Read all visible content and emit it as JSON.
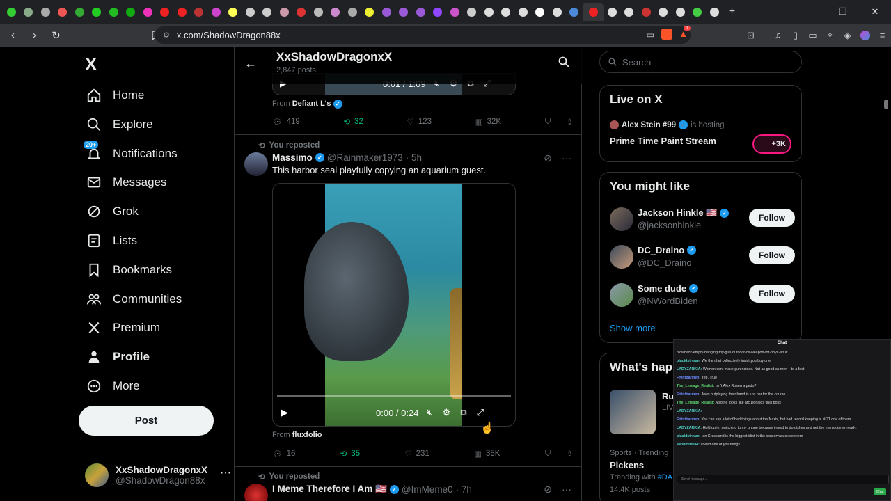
{
  "browser": {
    "url": "x.com/ShadowDragon88x",
    "tabs_count": 46,
    "new_tab": "+",
    "ext_badge": "1"
  },
  "nav": {
    "logo": "X",
    "items": [
      {
        "label": "Home",
        "icon": "home-icon"
      },
      {
        "label": "Explore",
        "icon": "search-icon"
      },
      {
        "label": "Notifications",
        "icon": "bell-icon"
      },
      {
        "label": "Messages",
        "icon": "mail-icon"
      },
      {
        "label": "Grok",
        "icon": "grok-icon"
      },
      {
        "label": "Lists",
        "icon": "list-icon"
      },
      {
        "label": "Bookmarks",
        "icon": "bookmark-icon"
      },
      {
        "label": "Communities",
        "icon": "people-icon"
      },
      {
        "label": "Premium",
        "icon": "x-icon"
      },
      {
        "label": "Profile",
        "icon": "person-icon"
      },
      {
        "label": "More",
        "icon": "more-icon"
      }
    ],
    "notif_badge": "20+",
    "post_label": "Post",
    "account_name": "XxShadowDragonxX",
    "account_handle": "@ShadowDragon88x",
    "account_more": "···"
  },
  "header": {
    "title": "XxShadowDragonxX",
    "subtitle": "2,847 posts"
  },
  "tweet1": {
    "video_time": "0:01 / 1:09",
    "from_label": "From",
    "from_name": "Defiant L's",
    "replies": "419",
    "reposts": "32",
    "likes": "123",
    "views": "32K"
  },
  "tweet2": {
    "reposted": "You reposted",
    "name": "Massimo",
    "handle": "@Rainmaker1973",
    "time": "· 5h",
    "text": "This harbor seal playfully copying an aquarium guest.",
    "video_time": "0:00 / 0:24",
    "from_label": "From",
    "from_name": "fluxfolio",
    "replies": "16",
    "reposts": "35",
    "likes": "231",
    "views": "35K"
  },
  "tweet3": {
    "reposted": "You reposted",
    "name": "I Meme Therefore I Am 🇺🇸",
    "handle": "@ImMeme0",
    "time": "· 7h"
  },
  "right": {
    "search_placeholder": "Search",
    "live_title": "Live on X",
    "live_host": "Alex Stein #99",
    "live_hosting": "is hosting",
    "live_stream": "Prime Time Paint Stream",
    "live_count": "+3K",
    "might_like_title": "You might like",
    "suggestions": [
      {
        "name": "Jackson Hinkle 🇺🇸",
        "handle": "@jacksonhinkle",
        "follow": "Follow"
      },
      {
        "name": "DC_Draino",
        "handle": "@DC_Draino",
        "follow": "Follow"
      },
      {
        "name": "Some dude",
        "handle": "@NWordBiden",
        "follow": "Follow"
      }
    ],
    "show_more": "Show more",
    "whats_happening": "What's hap",
    "trend_snippet": "Ru",
    "trend_live": "LIV",
    "trend_category": "Sports · Trending",
    "trend_name": "Pickens",
    "trend_with": "Trending with",
    "trend_tag": "#DA",
    "trend_posts": "14.4K posts"
  },
  "chat": {
    "title": "Chat",
    "lines": [
      {
        "user": "",
        "text": "blowback-empty-hanging-toy-gun-outdoor-cs-weapon-for-boys-adult",
        "color": "#8a8aff"
      },
      {
        "user": "placidstream:",
        "text": "We the chat collectively insist you buy one",
        "color": "#4fd1c5"
      },
      {
        "user": "LADYZARKIA:",
        "text": "Women cant make gun noises. Not as good as men . its a fact",
        "color": "#4fd1c5"
      },
      {
        "user": "Fr0ntbarmen:",
        "text": "Yep. True",
        "color": "#6c8cff"
      },
      {
        "user": "The_Lineage_Realist:",
        "text": "Isn't Alex Rosen a pedo?",
        "color": "#5ad16c"
      },
      {
        "user": "Fr0ntbarmen:",
        "text": "Jews outplaying their hand is just par for the course.",
        "color": "#6c8cff"
      },
      {
        "user": "The_Lineage_Realist:",
        "text": "Also he looks like Mc Donalds final boss",
        "color": "#5ad16c"
      },
      {
        "user": "LADYZARKIA:",
        "text": "",
        "color": "#4fd1c5"
      },
      {
        "user": "Fr0ntbarmen:",
        "text": "You can say a lot of bad things about the Nazis, but bad record keeping is NOT one of them.",
        "color": "#6c8cff"
      },
      {
        "user": "LADYZARKIA:",
        "text": "Hold up im switching to my phone because i need to do dishes and get the mans dinner ready.",
        "color": "#4fd1c5"
      },
      {
        "user": "placidstream:",
        "text": "Ian Crossland is the biggest idiot in the conservacuck sephere",
        "color": "#4fd1c5"
      },
      {
        "user": "44number44:",
        "text": "I need one of you things",
        "color": "#4fd1c5"
      }
    ],
    "input_placeholder": "Send message...",
    "send_label": "Chat"
  }
}
